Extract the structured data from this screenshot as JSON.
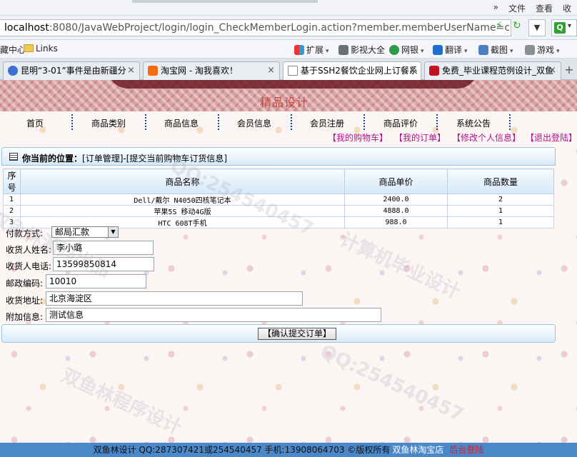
{
  "browser": {
    "menu": [
      "»",
      "文件",
      "查看",
      "收"
    ],
    "address": {
      "host": "localhost",
      "rest": ":8080/JavaWebProject/login/login_CheckMemberLogin.action?member.memberUserName=c"
    },
    "search_glyph": "Q",
    "favorites": {
      "left_cut": "藏中心",
      "links": "Links",
      "ext": "扩展",
      "video": "影视大全",
      "bank": "网银",
      "translate": "翻译",
      "screenshot": "截图",
      "games": "游戏"
    },
    "tabs": [
      {
        "title": "昆明“3-01”事件是由新疆分",
        "color": "#3b6fd1"
      },
      {
        "title": "淘宝网 - 淘我喜欢！",
        "color": "#f46b10"
      },
      {
        "title": "基于SSH2餐饮企业网上订餐系",
        "color": "#ffffff"
      },
      {
        "title": "免费_毕业课程范例设计_双鱼",
        "color": "#c4121f"
      }
    ],
    "close_glyph": "×",
    "newtab_glyph": "+"
  },
  "site": {
    "banner_subtitle": "精品设计",
    "nav": [
      "首页",
      "商品类别",
      "商品信息",
      "会员信息",
      "会员注册",
      "商品评价",
      "系统公告"
    ],
    "sublinks": [
      "【我的购物车】",
      "【我的订单】",
      "【修改个人信息】",
      "【退出登陆】"
    ]
  },
  "panel": {
    "label": "你当前的位置：",
    "path": "[订单管理]-[提交当前购物车订货信息]"
  },
  "table": {
    "headers": [
      "序号",
      "商品名称",
      "商品单价",
      "商品数量"
    ],
    "rows": [
      [
        "1",
        "Dell/戴尔 N4050四核笔记本",
        "2400.0",
        "2"
      ],
      [
        "2",
        "苹果5S 移动4G版",
        "4888.0",
        "1"
      ],
      [
        "3",
        "HTC 608T手机",
        "988.0",
        "1"
      ]
    ]
  },
  "form": {
    "payment_label": "付款方式:",
    "payment_value": "邮局汇款",
    "name_label": "收货人姓名:",
    "name_value": "李小璐",
    "phone_label": "收货人电话:",
    "phone_value": "13599850814",
    "postcode_label": "邮政编码:",
    "postcode_value": "10010",
    "address_label": "收货地址:",
    "address_value": "北京海淀区",
    "memo_label": "附加信息:",
    "memo_value": "测试信息"
  },
  "submit_label": "【确认提交订单】",
  "footer": {
    "text": "双鱼林设计 QQ:287307421或254540457 手机:13908064703 ©版权所有",
    "shop": "双鱼林淘宝店",
    "admin": "后台登陆"
  },
  "watermarks": [
    "双鱼林源码出品",
    "QQ:254540457",
    "计算机毕业设计",
    "双鱼林程序设计"
  ]
}
